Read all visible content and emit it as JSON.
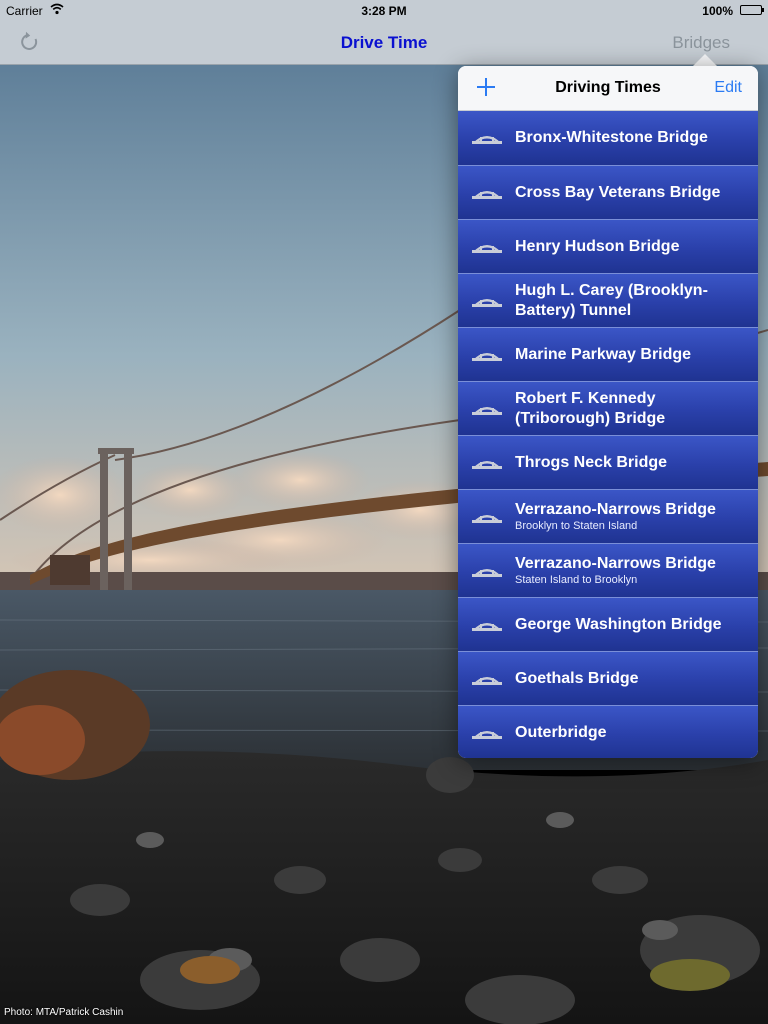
{
  "status_bar": {
    "carrier": "Carrier",
    "time": "3:28 PM",
    "battery": "100%"
  },
  "nav_bar": {
    "title": "Drive Time",
    "right_button": "Bridges",
    "left_icon": "refresh-icon"
  },
  "popover": {
    "title": "Driving Times",
    "add_icon": "plus-icon",
    "edit_label": "Edit",
    "items": [
      {
        "name": "Bronx-Whitestone Bridge",
        "subtitle": ""
      },
      {
        "name": "Cross Bay Veterans Bridge",
        "subtitle": ""
      },
      {
        "name": "Henry Hudson Bridge",
        "subtitle": ""
      },
      {
        "name": "Hugh L. Carey (Brooklyn-Battery) Tunnel",
        "subtitle": ""
      },
      {
        "name": "Marine Parkway Bridge",
        "subtitle": ""
      },
      {
        "name": "Robert F. Kennedy (Triborough) Bridge",
        "subtitle": ""
      },
      {
        "name": "Throgs Neck Bridge",
        "subtitle": ""
      },
      {
        "name": "Verrazano-Narrows Bridge",
        "subtitle": "Brooklyn to Staten Island"
      },
      {
        "name": "Verrazano-Narrows Bridge",
        "subtitle": "Staten Island to Brooklyn"
      },
      {
        "name": "George Washington Bridge",
        "subtitle": ""
      },
      {
        "name": "Goethals Bridge",
        "subtitle": ""
      },
      {
        "name": "Outerbridge",
        "subtitle": ""
      }
    ]
  },
  "photo_credit": "Photo: MTA/Patrick Cashin",
  "colors": {
    "nav_title": "#0a10d0",
    "accent": "#2b7bf3",
    "row_blue": "#2a40aa"
  }
}
